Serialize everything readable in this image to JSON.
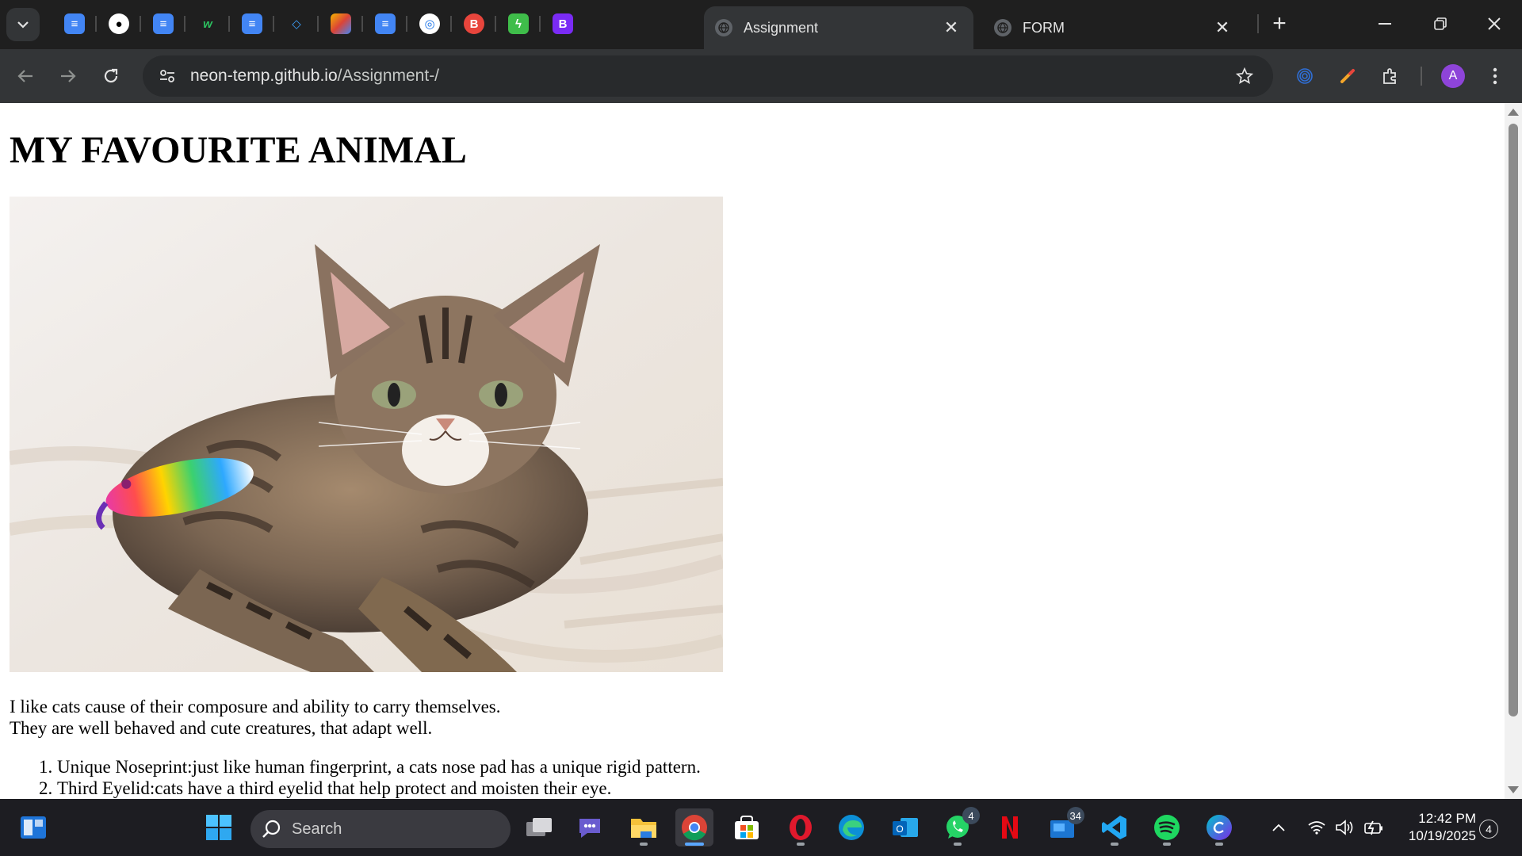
{
  "browser": {
    "tabs": [
      {
        "title": "Assignment",
        "active": true
      },
      {
        "title": "FORM",
        "active": false
      }
    ],
    "pinned_tabs": [
      "google-docs-icon",
      "github-icon",
      "google-docs-icon",
      "wordwall-icon",
      "google-docs-icon",
      "diamond-icon",
      "colorful-logo-icon",
      "google-docs-icon",
      "chrome-target-icon",
      "b-circle-icon",
      "green-bolt-icon",
      "bootstrap-icon"
    ],
    "address": {
      "host": "neon-temp.github.io",
      "path": "/Assignment-/"
    },
    "profile_initial": "A"
  },
  "page": {
    "heading": "MY FAVOURITE ANIMAL",
    "image_subject": "tabby kitten with rainbow toy",
    "paragraph_line1": "I like cats cause of their composure and ability to carry themselves.",
    "paragraph_line2": "They are well behaved and cute creatures, that adapt well.",
    "list": [
      "Unique Noseprint:just like human fingerprint, a cats nose pad has a unique rigid pattern.",
      "Third Eyelid:cats have a third eyelid that help protect and moisten their eye."
    ]
  },
  "taskbar": {
    "search_label": "Search",
    "whatsapp_badge": "4",
    "outlook_badge": "34",
    "time": "12:42 PM",
    "date": "10/19/2025",
    "notification_count": "4"
  },
  "colors": {
    "chrome_dark": "#1f1f1f",
    "toolbar": "#333537",
    "accent": "#5aa7ff"
  }
}
